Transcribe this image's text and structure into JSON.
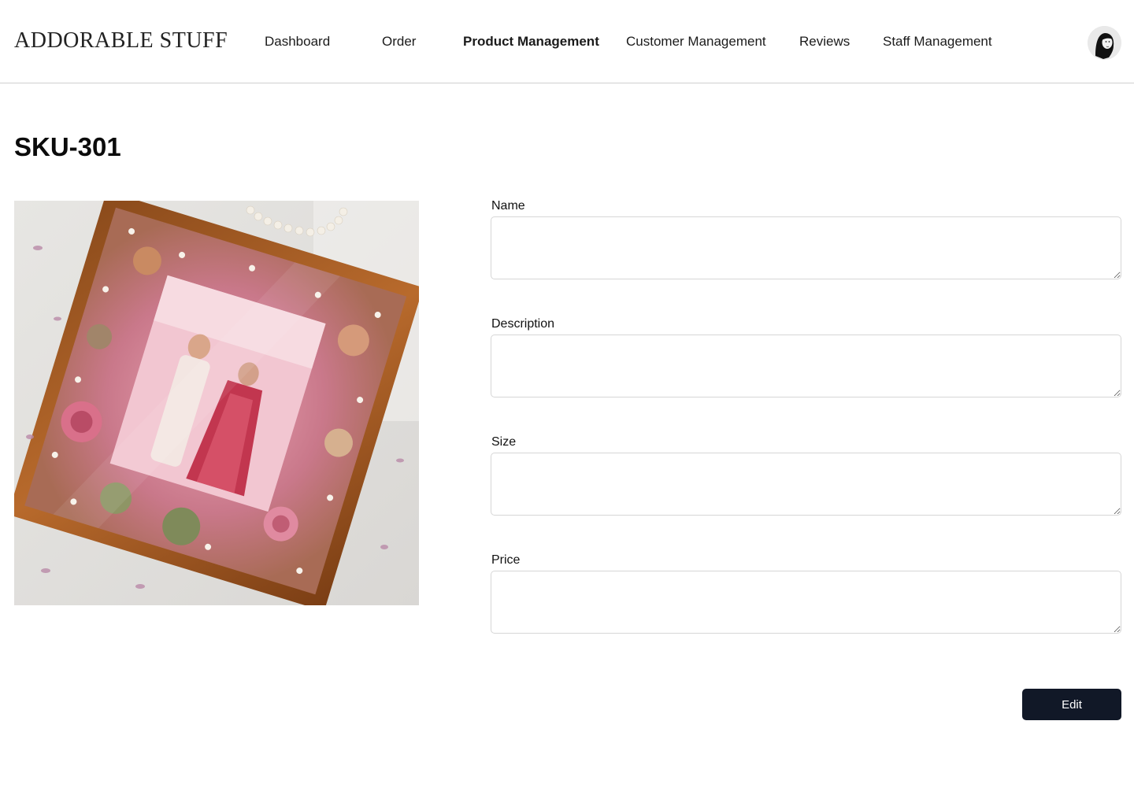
{
  "brand": {
    "logo_text": "Addorable Stuff"
  },
  "nav": {
    "items": [
      {
        "label": "Dashboard"
      },
      {
        "label": "Order"
      },
      {
        "label": "Product Management",
        "active": true
      },
      {
        "label": "Customer Management"
      },
      {
        "label": "Reviews"
      },
      {
        "label": "Staff Management"
      }
    ]
  },
  "user": {
    "avatar_icon": "user-avatar-icon"
  },
  "product": {
    "sku": "SKU-301",
    "image_alt": "framed preserved-flower wedding photo"
  },
  "form": {
    "name_label": "Name",
    "name_value": "",
    "description_label": "Description",
    "description_value": "",
    "size_label": "Size",
    "size_value": "",
    "price_label": "Price",
    "price_value": ""
  },
  "actions": {
    "edit_label": "Edit"
  },
  "colors": {
    "primary_button": "#111827",
    "border": "#d6d6d6",
    "header_border": "#cfcfcf"
  }
}
